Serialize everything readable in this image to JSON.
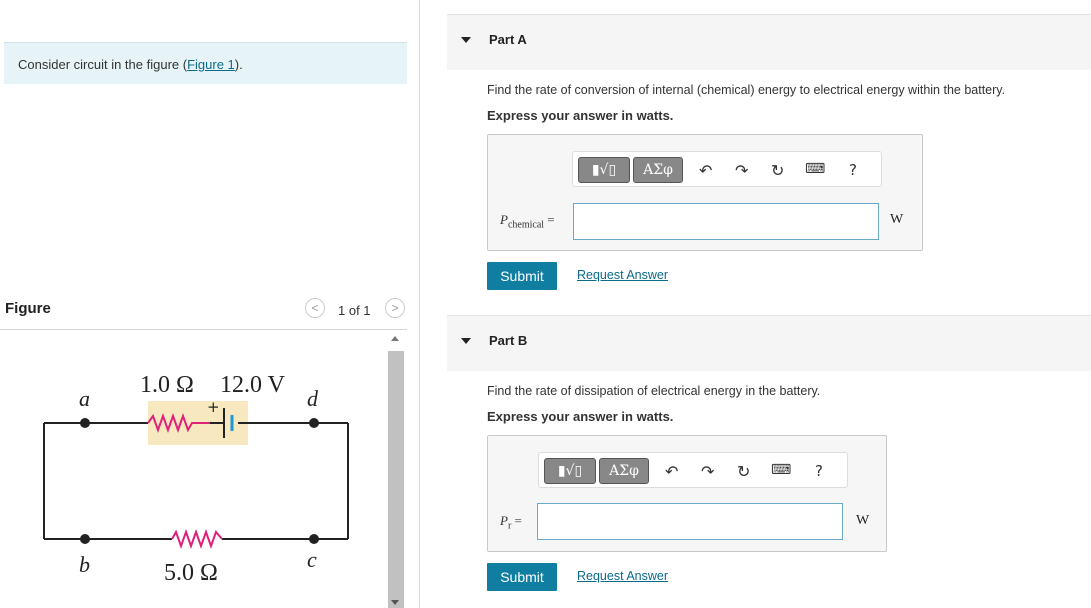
{
  "intro": {
    "text": "Consider circuit in the figure (",
    "link": "Figure 1",
    "suffix": ")."
  },
  "figure": {
    "title": "Figure",
    "pager": "1 of 1",
    "prev_icon": "<",
    "next_icon": ">",
    "circuit": {
      "r_internal": "1.0 Ω",
      "emf": "12.0 V",
      "r_external": "5.0 Ω",
      "node_a": "a",
      "node_b": "b",
      "node_c": "c",
      "node_d": "d",
      "plus": "+"
    }
  },
  "toolbar": {
    "template_label": "▮√▯",
    "greek_label": "ΑΣφ",
    "help_label": "?"
  },
  "partA": {
    "title": "Part A",
    "question": "Find the rate of conversion of internal (chemical) energy to electrical energy within the battery.",
    "instruction": "Express your answer in watts.",
    "var_main": "P",
    "var_sub": "chemical",
    "equals": "=",
    "unit": "W",
    "submit": "Submit",
    "request": "Request Answer"
  },
  "partB": {
    "title": "Part B",
    "question": "Find the rate of dissipation of electrical energy in the battery.",
    "instruction": "Express your answer in watts.",
    "var_main": "P",
    "var_sub": "r",
    "equals": "=",
    "unit": "W",
    "submit": "Submit",
    "request": "Request Answer"
  }
}
